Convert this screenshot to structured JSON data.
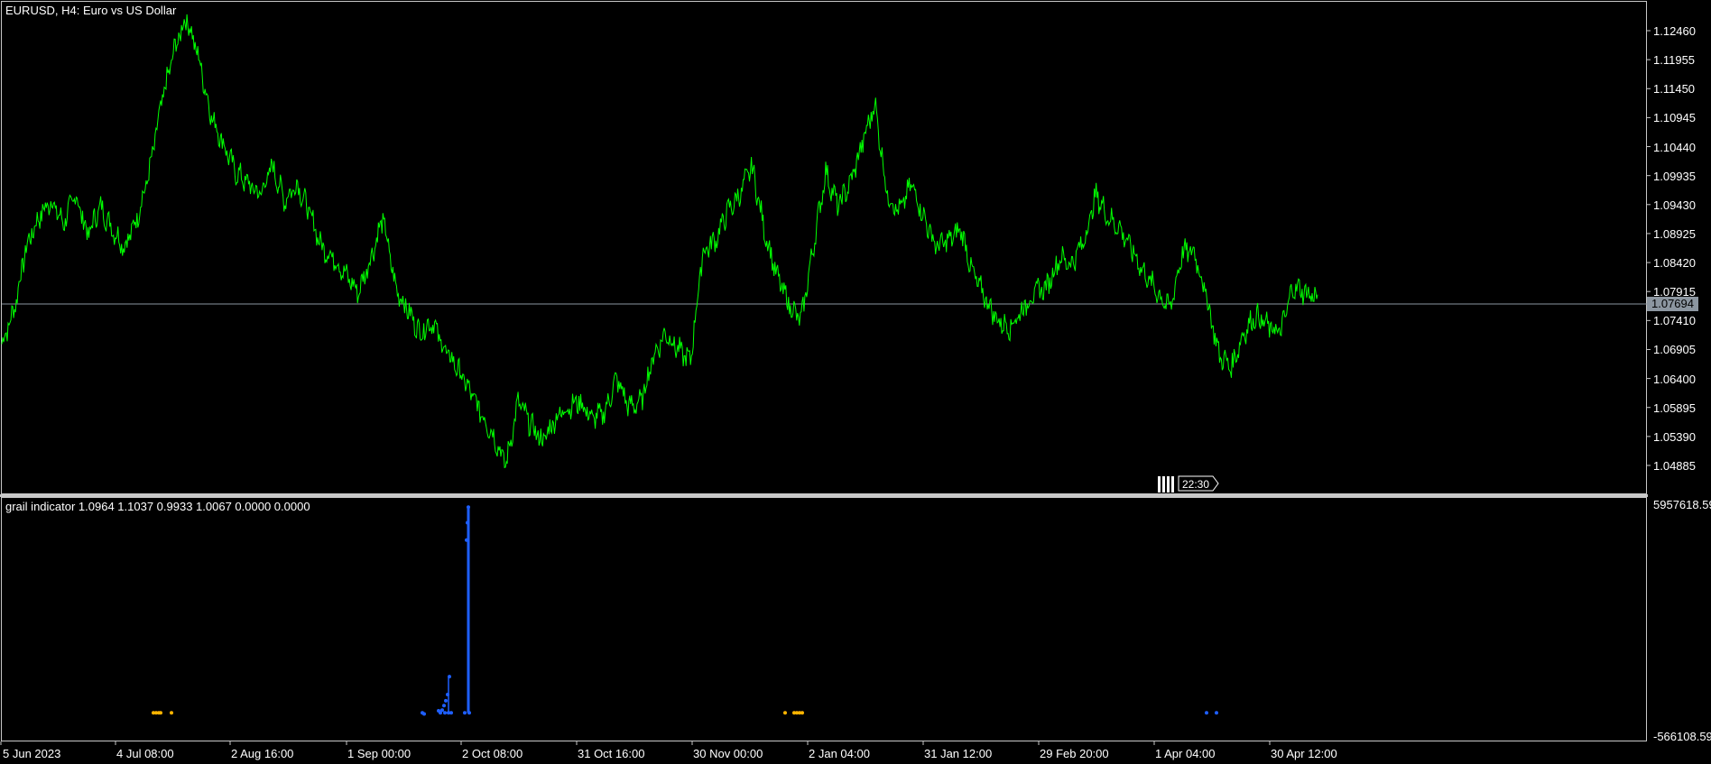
{
  "chart_window": {
    "symbol_title": "EURUSD, H4:  Euro vs US Dollar",
    "current_price": "1.07694",
    "bar_timer": "22:30",
    "price_axis": [
      "1.12460",
      "1.11955",
      "1.11450",
      "1.10945",
      "1.10440",
      "1.09935",
      "1.09430",
      "1.08925",
      "1.08420",
      "1.07915",
      "1.07410",
      "1.06905",
      "1.06400",
      "1.05895",
      "1.05390",
      "1.04885"
    ],
    "time_axis": [
      "5 Jun 2023",
      "4 Jul 08:00",
      "2 Aug 16:00",
      "1 Sep 00:00",
      "2 Oct 08:00",
      "31 Oct 16:00",
      "30 Nov 00:00",
      "2 Jan 04:00",
      "31 Jan 12:00",
      "29 Feb 20:00",
      "1 Apr 04:00",
      "30 Apr 12:00"
    ],
    "colors": {
      "price_line": "#00ff00",
      "grid_line": "#8c96a0",
      "indicator_blue": "#1e5fff",
      "indicator_orange": "#ffb400"
    }
  },
  "indicator": {
    "title": "grail indicator 1.0964 1.1037 0.9933 1.0067 0.0000 0.0000",
    "max_label": "5957618.59",
    "min_label": "-566108.59"
  },
  "chart_data": [
    {
      "type": "line",
      "title": "EURUSD, H4:  Euro vs US Dollar",
      "xlabel": "",
      "ylabel": "",
      "ylim": [
        1.0463,
        1.1279
      ],
      "series": [
        {
          "values": [
            1.07,
            1.076,
            1.087,
            1.092,
            1.095,
            1.091,
            1.096,
            1.089,
            1.094,
            1.09,
            1.087,
            1.092,
            1.1,
            1.112,
            1.121,
            1.127,
            1.12,
            1.11,
            1.105,
            1.1,
            1.098,
            1.096,
            1.101,
            1.095,
            1.098,
            1.093,
            1.087,
            1.085,
            1.082,
            1.079,
            1.085,
            1.092,
            1.08,
            1.076,
            1.072,
            1.074,
            1.069,
            1.066,
            1.062,
            1.058,
            1.054,
            1.049,
            1.06,
            1.056,
            1.053,
            1.057,
            1.059,
            1.06,
            1.057,
            1.058,
            1.064,
            1.059,
            1.06,
            1.068,
            1.072,
            1.069,
            1.067,
            1.086,
            1.088,
            1.093,
            1.096,
            1.101,
            1.09,
            1.082,
            1.077,
            1.074,
            1.087,
            1.1,
            1.094,
            1.098,
            1.105,
            1.112,
            1.096,
            1.093,
            1.098,
            1.092,
            1.087,
            1.088,
            1.09,
            1.082,
            1.078,
            1.074,
            1.073,
            1.076,
            1.079,
            1.08,
            1.085,
            1.084,
            1.088,
            1.096,
            1.092,
            1.09,
            1.086,
            1.082,
            1.079,
            1.076,
            1.086,
            1.086,
            1.078,
            1.068,
            1.066,
            1.072,
            1.075,
            1.073,
            1.072,
            1.08,
            1.079,
            1.078
          ]
        }
      ]
    },
    {
      "type": "scatter",
      "title": "grail indicator 1.0964 1.1037 0.9933 1.0067 0.0000 0.0000",
      "ylim": [
        -566108.59,
        5957618.59
      ],
      "blue_points": [
        [
          468,
          0
        ],
        [
          470,
          -30000
        ],
        [
          486,
          60000
        ],
        [
          488,
          0
        ],
        [
          490,
          80000
        ],
        [
          492,
          210000
        ],
        [
          493,
          0
        ],
        [
          494,
          350000
        ],
        [
          496,
          530000
        ],
        [
          497,
          0
        ],
        [
          498,
          1050000
        ],
        [
          500,
          0
        ],
        [
          515,
          0
        ],
        [
          517,
          5000000
        ],
        [
          518,
          5500000
        ],
        [
          519,
          5950000
        ],
        [
          520,
          0
        ],
        [
          1337,
          0
        ],
        [
          1348,
          0
        ]
      ],
      "orange_points": [
        [
          170,
          0
        ],
        [
          173,
          0
        ],
        [
          176,
          0
        ],
        [
          178,
          0
        ],
        [
          190,
          0
        ],
        [
          870,
          0
        ],
        [
          880,
          0
        ],
        [
          883,
          0
        ],
        [
          886,
          0
        ],
        [
          889,
          0
        ]
      ],
      "blue_spikes": [
        [
          497,
          1050000
        ],
        [
          519,
          5950000
        ]
      ]
    }
  ]
}
